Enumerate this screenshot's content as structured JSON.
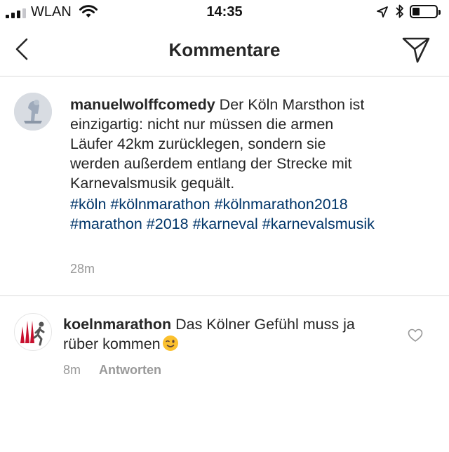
{
  "status_bar": {
    "carrier": "WLAN",
    "time": "14:35"
  },
  "nav": {
    "title": "Kommentare"
  },
  "caption": {
    "username": "manuelwolffcomedy",
    "text": " Der Köln Marsthon ist einzigartig: nicht nur müssen die armen Läufer 42km zurücklegen, sondern sie werden außerdem entlang der Strecke mit Karnevalsmusik gequält.",
    "hashtags": [
      "#köln",
      "#kölnmarathon",
      "#kölnmarathon2018",
      "#marathon",
      "#2018",
      "#karneval",
      "#karnevalsmusik"
    ],
    "time": "28m"
  },
  "reply_comment": {
    "username": "koelnmarathon",
    "text": " Das Kölner Gefühl muss ja rüber kommen",
    "time": "8m",
    "reply_label": "Antworten"
  },
  "colors": {
    "hashtag": "#003569",
    "meta": "#999999",
    "divider": "#dbdbdb",
    "logo_red": "#c8102e"
  }
}
